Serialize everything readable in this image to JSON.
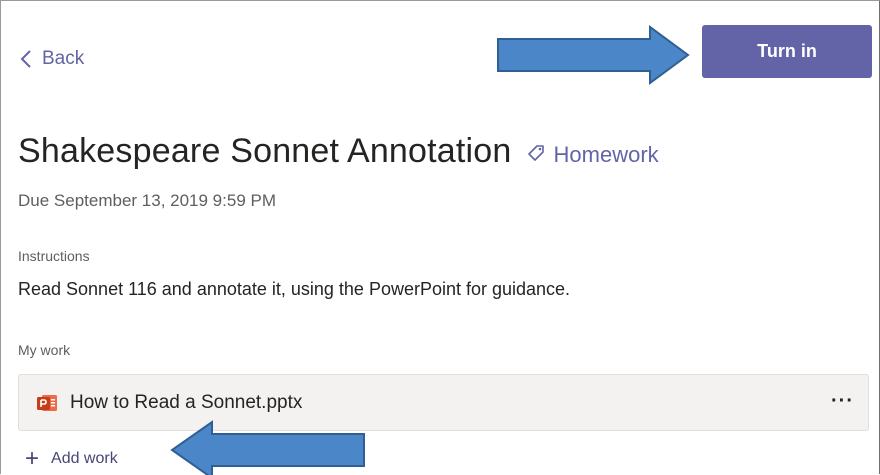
{
  "header": {
    "back_label": "Back",
    "turn_in_label": "Turn in"
  },
  "assignment": {
    "title": "Shakespeare Sonnet Annotation",
    "category": "Homework",
    "due": "Due September 13, 2019 9:59 PM",
    "instructions_label": "Instructions",
    "instructions_text": "Read Sonnet 116 and annotate it, using the PowerPoint for guidance."
  },
  "my_work": {
    "label": "My work",
    "files": [
      {
        "name": "How to Read a Sonnet.pptx",
        "icon": "powerpoint-file-icon",
        "more_label": "···"
      }
    ],
    "add_work_label": "Add work"
  },
  "colors": {
    "accent": "#6264a7",
    "annotation_arrow": "#4a86c8",
    "annotation_arrow_border": "#2f5f93"
  }
}
